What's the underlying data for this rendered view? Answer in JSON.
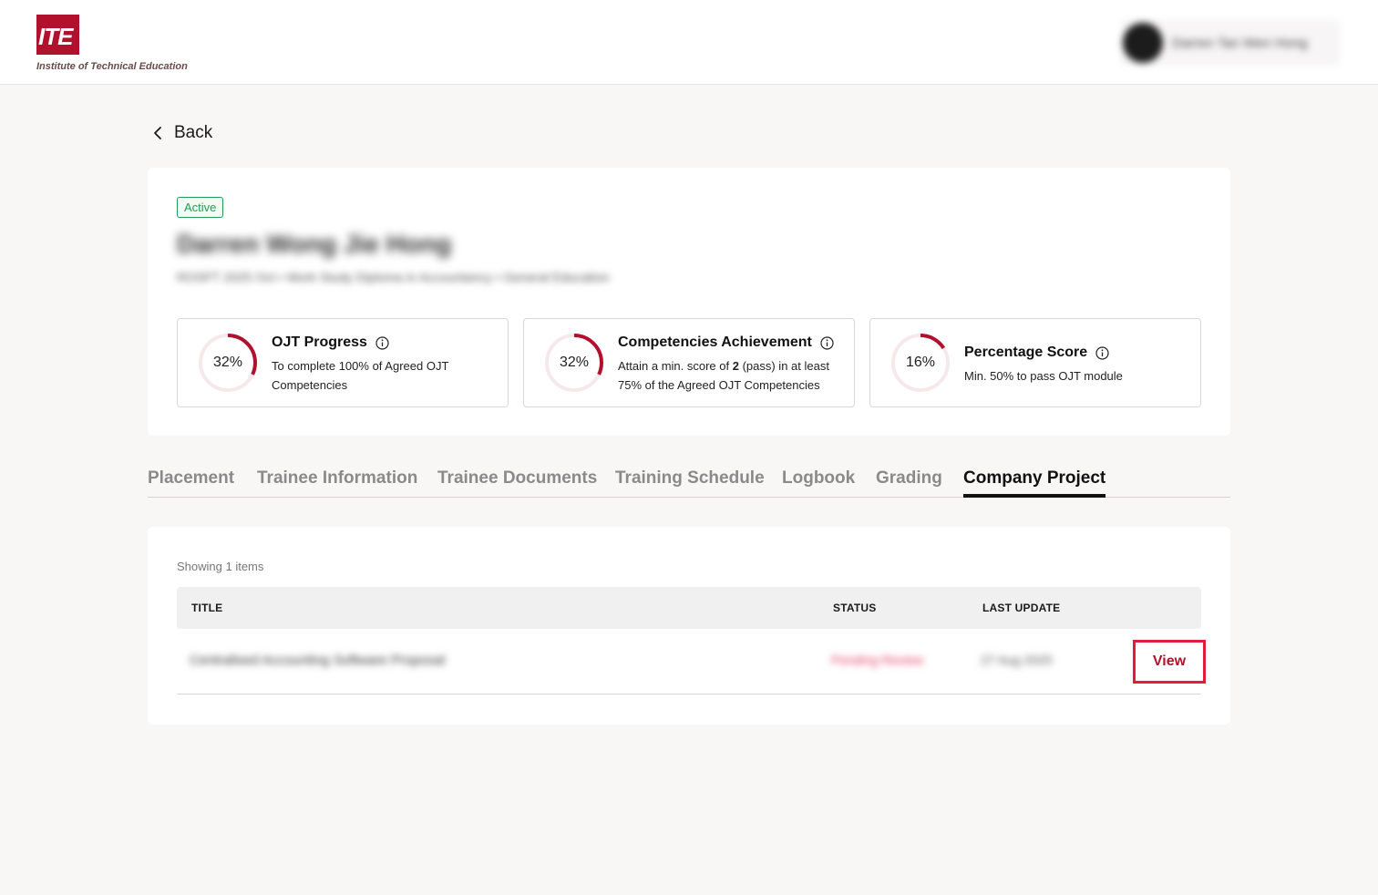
{
  "header": {
    "logo_mark": "ITE",
    "logo_text": "Institute of Technical Education",
    "user_name": "Darren Tan Wen Hong"
  },
  "nav": {
    "back_label": "Back"
  },
  "trainee": {
    "status_badge": "Active",
    "name": "Darren Wong Jie Hong",
    "meta": "ROSFT 2025 Oct  •  Work Study Diploma in Accountancy  •  General Education"
  },
  "stats": [
    {
      "percent": "32%",
      "value": 32,
      "title": "OJT Progress",
      "desc_html": "To complete 100% of Agreed OJT Competencies"
    },
    {
      "percent": "32%",
      "value": 32,
      "title": "Competencies Achievement",
      "desc_pre": "Attain a min. score of ",
      "desc_bold": "2",
      "desc_post": " (pass) in at least 75% of the Agreed OJT Competencies"
    },
    {
      "percent": "16%",
      "value": 16,
      "title": "Percentage Score",
      "desc_html": "Min. 50% to pass OJT module"
    }
  ],
  "colors": {
    "accent": "#b0122d",
    "ring_track": "#f6e9ec",
    "badge_green": "#1f9d55",
    "highlight_border": "#e01e37"
  },
  "tabs": [
    {
      "label": "Placement",
      "active": false
    },
    {
      "label": "Trainee Information",
      "active": false
    },
    {
      "label": "Trainee Documents",
      "active": false
    },
    {
      "label": "Training Schedule",
      "active": false
    },
    {
      "label": "Logbook",
      "active": false
    },
    {
      "label": "Grading",
      "active": false
    },
    {
      "label": "Company Project",
      "active": true
    }
  ],
  "list": {
    "showing": "Showing 1 items",
    "columns": {
      "title": "TITLE",
      "status": "STATUS",
      "last_update": "LAST UPDATE"
    },
    "rows": [
      {
        "title": "Centralised Accounting Software Proposal",
        "status": "Pending Review",
        "last_update": "27 Aug 2025",
        "action": "View"
      }
    ]
  }
}
